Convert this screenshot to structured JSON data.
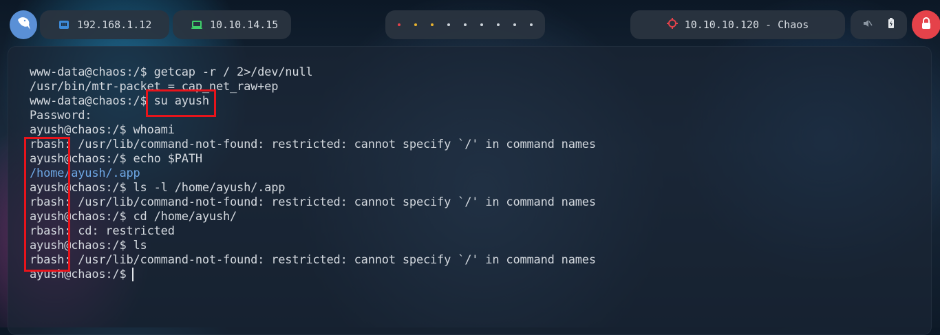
{
  "topbar": {
    "logo_icon": "kali-dragon-icon",
    "host_ip": {
      "icon": "network-interface-icon",
      "label": "192.168.1.12"
    },
    "vpn_ip": {
      "icon": "vpn-laptop-icon",
      "label": "10.10.14.15"
    },
    "workspaces": {
      "count": 9,
      "active_colors": [
        "#e5424a",
        "#e8b22e",
        "#e8b22e"
      ]
    },
    "target": {
      "icon": "crosshair-target-icon",
      "label": "10.10.10.120 - Chaos"
    },
    "status": {
      "icons": [
        "volume-muted-icon",
        "battery-icon"
      ]
    },
    "lock": {
      "icon": "lock-icon"
    }
  },
  "terminal": {
    "lines": [
      {
        "text": "www-data@chaos:/$ getcap -r / 2>/dev/null"
      },
      {
        "text": "/usr/bin/mtr-packet = cap_net_raw+ep"
      },
      {
        "text": "www-data@chaos:/$ su ayush"
      },
      {
        "text": "Password:"
      },
      {
        "text": "ayush@chaos:/$ whoami"
      },
      {
        "text": "rbash: /usr/lib/command-not-found: restricted: cannot specify `/' in command names"
      },
      {
        "text": "ayush@chaos:/$ echo $PATH"
      },
      {
        "text": "/home/ayush/.app",
        "style": "blue"
      },
      {
        "text": "ayush@chaos:/$ ls -l /home/ayush/.app"
      },
      {
        "text": "rbash: /usr/lib/command-not-found: restricted: cannot specify `/' in command names"
      },
      {
        "text": "ayush@chaos:/$ cd /home/ayush/"
      },
      {
        "text": "rbash: cd: restricted"
      },
      {
        "text": "ayush@chaos:/$ ls"
      },
      {
        "text": "rbash: /usr/lib/command-not-found: restricted: cannot specify `/' in command names"
      },
      {
        "text": "ayush@chaos:/$ "
      }
    ]
  },
  "colors": {
    "highlight_box": "#e8141b",
    "path_output": "#6fa8e6",
    "lock_button": "#e5424a"
  }
}
